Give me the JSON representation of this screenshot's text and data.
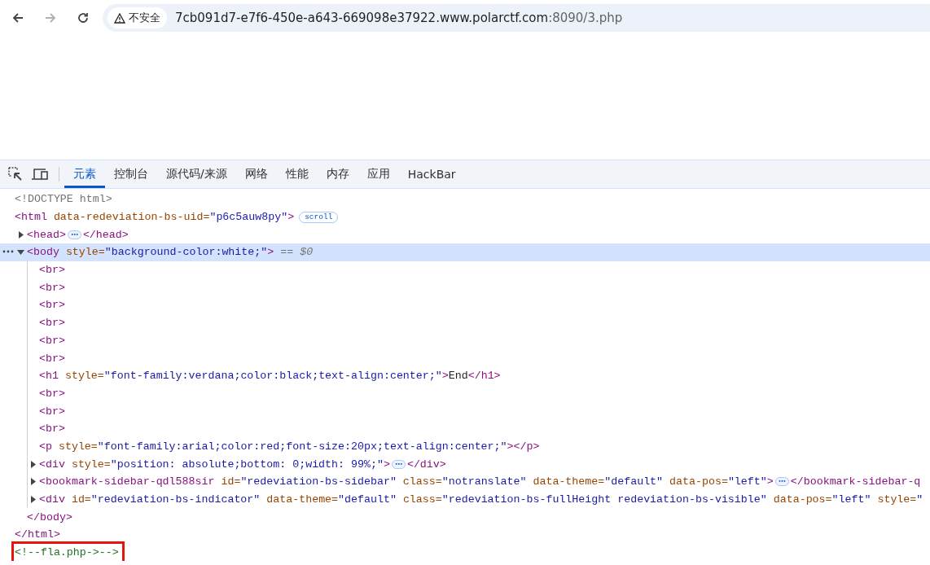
{
  "browser": {
    "nav": [
      {
        "kind": "back",
        "disabled": false
      },
      {
        "kind": "forward",
        "disabled": true
      },
      {
        "kind": "reload",
        "disabled": false
      }
    ],
    "security": "不安全",
    "url": {
      "host": "7cb091d7-e7f6-450e-a643-669098e37922.www.polarctf.com",
      "rest": ":8090/3.php"
    }
  },
  "devtools": {
    "tabs": [
      {
        "label": "元素",
        "selected": true
      },
      {
        "label": "控制台",
        "selected": false
      },
      {
        "label": "源代码/来源",
        "selected": false
      },
      {
        "label": "网络",
        "selected": false
      },
      {
        "label": "性能",
        "selected": false
      },
      {
        "label": "内存",
        "selected": false
      },
      {
        "label": "应用",
        "selected": false
      },
      {
        "label": "HackBar",
        "selected": false
      }
    ],
    "tree": [
      {
        "selected": false,
        "tokens": [
          {
            "kind": "doctype",
            "text": "<!DOCTYPE html>"
          }
        ]
      },
      {
        "selected": false,
        "tokens": [
          {
            "kind": "tag",
            "text": "<html"
          },
          {
            "kind": "attr",
            "text": " data-redeviation-bs-uid="
          },
          {
            "kind": "value",
            "text": "\"p6c5auw8py\""
          },
          {
            "kind": "tag",
            "text": ">"
          },
          {
            "kind": "badge",
            "text": "scroll"
          }
        ],
        "close": [
          {
            "kind": "tag",
            "text": "</html>"
          }
        ],
        "children": [
          {
            "selected": false,
            "expanded": false,
            "tokens": [
              {
                "kind": "tag",
                "text": "<head>"
              },
              {
                "kind": "more",
                "text": "⋯"
              },
              {
                "kind": "tag",
                "text": "</head>"
              }
            ]
          },
          {
            "selected": true,
            "expanded": true,
            "tokens": [
              {
                "kind": "tag",
                "text": "<body"
              },
              {
                "kind": "attr",
                "text": " style="
              },
              {
                "kind": "value",
                "text": "\"background-color:white;\""
              },
              {
                "kind": "tag",
                "text": ">"
              },
              {
                "kind": "ref",
                "text": " == $0"
              }
            ],
            "close": [
              {
                "kind": "tag",
                "text": "</body>"
              }
            ],
            "children": [
              {
                "selected": false,
                "tokens": [
                  {
                    "kind": "tag",
                    "text": "<br>"
                  }
                ]
              },
              {
                "selected": false,
                "tokens": [
                  {
                    "kind": "tag",
                    "text": "<br>"
                  }
                ]
              },
              {
                "selected": false,
                "tokens": [
                  {
                    "kind": "tag",
                    "text": "<br>"
                  }
                ]
              },
              {
                "selected": false,
                "tokens": [
                  {
                    "kind": "tag",
                    "text": "<br>"
                  }
                ]
              },
              {
                "selected": false,
                "tokens": [
                  {
                    "kind": "tag",
                    "text": "<br>"
                  }
                ]
              },
              {
                "selected": false,
                "tokens": [
                  {
                    "kind": "tag",
                    "text": "<br>"
                  }
                ]
              },
              {
                "selected": false,
                "tokens": [
                  {
                    "kind": "tag",
                    "text": "<h1"
                  },
                  {
                    "kind": "attr",
                    "text": " style="
                  },
                  {
                    "kind": "value",
                    "text": "\"font-family:verdana;color:black;text-align:center;\""
                  },
                  {
                    "kind": "tag",
                    "text": ">"
                  },
                  {
                    "kind": "text",
                    "text": "End"
                  },
                  {
                    "kind": "tag",
                    "text": "</h1>"
                  }
                ]
              },
              {
                "selected": false,
                "tokens": [
                  {
                    "kind": "tag",
                    "text": "<br>"
                  }
                ]
              },
              {
                "selected": false,
                "tokens": [
                  {
                    "kind": "tag",
                    "text": "<br>"
                  }
                ]
              },
              {
                "selected": false,
                "tokens": [
                  {
                    "kind": "tag",
                    "text": "<br>"
                  }
                ]
              },
              {
                "selected": false,
                "tokens": [
                  {
                    "kind": "tag",
                    "text": "<p"
                  },
                  {
                    "kind": "attr",
                    "text": " style="
                  },
                  {
                    "kind": "value",
                    "text": "\"font-family:arial;color:red;font-size:20px;text-align:center;\""
                  },
                  {
                    "kind": "tag",
                    "text": "></p>"
                  }
                ]
              },
              {
                "selected": false,
                "expanded": false,
                "tokens": [
                  {
                    "kind": "tag",
                    "text": "<div"
                  },
                  {
                    "kind": "attr",
                    "text": " style="
                  },
                  {
                    "kind": "value",
                    "text": "\"position: absolute;bottom: 0;width: 99%;\""
                  },
                  {
                    "kind": "tag",
                    "text": ">"
                  },
                  {
                    "kind": "more",
                    "text": "⋯"
                  },
                  {
                    "kind": "tag",
                    "text": "</div>"
                  }
                ]
              },
              {
                "selected": false,
                "expanded": false,
                "tokens": [
                  {
                    "kind": "tag",
                    "text": "<bookmark-sidebar-qdl588sir"
                  },
                  {
                    "kind": "attr",
                    "text": " id="
                  },
                  {
                    "kind": "value",
                    "text": "\"redeviation-bs-sidebar\""
                  },
                  {
                    "kind": "attr",
                    "text": " class="
                  },
                  {
                    "kind": "value",
                    "text": "\"notranslate\""
                  },
                  {
                    "kind": "attr",
                    "text": " data-theme="
                  },
                  {
                    "kind": "value",
                    "text": "\"default\""
                  },
                  {
                    "kind": "attr",
                    "text": " data-pos="
                  },
                  {
                    "kind": "value",
                    "text": "\"left\""
                  },
                  {
                    "kind": "tag",
                    "text": ">"
                  },
                  {
                    "kind": "more",
                    "text": "⋯"
                  },
                  {
                    "kind": "tag",
                    "text": "</bookmark-sidebar-q"
                  }
                ]
              },
              {
                "selected": false,
                "expanded": false,
                "tokens": [
                  {
                    "kind": "tag",
                    "text": "<div"
                  },
                  {
                    "kind": "attr",
                    "text": " id="
                  },
                  {
                    "kind": "value",
                    "text": "\"redeviation-bs-indicator\""
                  },
                  {
                    "kind": "attr",
                    "text": " data-theme="
                  },
                  {
                    "kind": "value",
                    "text": "\"default\""
                  },
                  {
                    "kind": "attr",
                    "text": " class="
                  },
                  {
                    "kind": "value",
                    "text": "\"redeviation-bs-fullHeight redeviation-bs-visible\""
                  },
                  {
                    "kind": "attr",
                    "text": " data-pos="
                  },
                  {
                    "kind": "value",
                    "text": "\"left\""
                  },
                  {
                    "kind": "attr",
                    "text": " style="
                  },
                  {
                    "kind": "value",
                    "text": "\""
                  }
                ]
              }
            ]
          }
        ]
      },
      {
        "selected": false,
        "annotated": true,
        "tokens": [
          {
            "kind": "comment",
            "text": "<!--fla.php->-->"
          }
        ]
      }
    ]
  }
}
